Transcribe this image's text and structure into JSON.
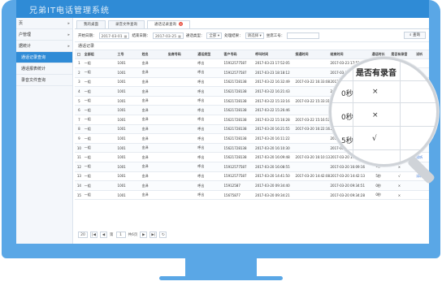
{
  "app": {
    "title": "兄弟IT电话管理系统"
  },
  "sidebar": {
    "items": [
      {
        "label": "页",
        "type": "group"
      },
      {
        "label": "户管理",
        "type": "group"
      },
      {
        "label": "据统计",
        "type": "group"
      },
      {
        "label": "通话记录查询",
        "type": "sub",
        "active": true
      },
      {
        "label": "通话报表统计",
        "type": "sub"
      },
      {
        "label": "录音文件查询",
        "type": "sub"
      }
    ]
  },
  "tabs": [
    {
      "label": "我的桌面"
    },
    {
      "label": "录音文件查询"
    },
    {
      "label": "通话记录查询",
      "active": true,
      "close": "×"
    }
  ],
  "filters": {
    "start_label": "开始日期：",
    "start_value": "2017-03-01",
    "end_label": "结束日期：",
    "end_value": "2017-03-25",
    "type_label": "通话类型：",
    "type_value": "全部",
    "result_label": "处理结果：",
    "result_value": "请选择",
    "agent_label": "坐席工号：",
    "agent_value": "",
    "search_label": "查询"
  },
  "section_title": "通话记录",
  "table": {
    "headers": [
      "全部组",
      "工号",
      "姓名",
      "坐席号码",
      "通话类型",
      "客户号码",
      "呼叫时间",
      "接通时间",
      "结束时间",
      "通话时长",
      "是否有录音",
      "试听"
    ],
    "rows": [
      {
        "no": "1",
        "group": "一组",
        "id": "1001",
        "name": "金泽",
        "ext": "",
        "type": "呼出",
        "phone": "15912577587",
        "call": "2017-03-23 17:52:05",
        "answer": "",
        "end": "2017-03-23 17:52:24",
        "dur": "",
        "rec": "",
        "play": ""
      },
      {
        "no": "2",
        "group": "一组",
        "id": "1001",
        "name": "金泽",
        "ext": "",
        "type": "呼出",
        "phone": "15912577587",
        "call": "2017-03-23 18:18:12",
        "answer": "",
        "end": "2017-03-23 18:18:31",
        "dur": "",
        "rec": "",
        "play": ""
      },
      {
        "no": "3",
        "group": "一组",
        "id": "1001",
        "name": "金泽",
        "ext": "",
        "type": "呼出",
        "phone": "15621728138",
        "call": "2017-03-22 16:32:49",
        "answer": "2017-03-22 16:33:08",
        "end": "2017-03-22 16:33:09",
        "dur": "",
        "rec": "",
        "play": ""
      },
      {
        "no": "4",
        "group": "一组",
        "id": "1001",
        "name": "金泽",
        "ext": "",
        "type": "呼出",
        "phone": "15621728138",
        "call": "2017-03-22 16:21:43",
        "answer": "",
        "end": "2017-03-22 16:22:01",
        "dur": "",
        "rec": "",
        "play": ""
      },
      {
        "no": "5",
        "group": "一组",
        "id": "1001",
        "name": "金泽",
        "ext": "",
        "type": "呼出",
        "phone": "15621728138",
        "call": "2017-03-22 15:33:16",
        "answer": "2017-03-22 15:33:31",
        "end": "2017-03-22 15:33:44",
        "dur": "",
        "rec": "",
        "play": ""
      },
      {
        "no": "6",
        "group": "一组",
        "id": "1001",
        "name": "金泽",
        "ext": "",
        "type": "呼出",
        "phone": "15621728138",
        "call": "2017-03-22 15:26:46",
        "answer": "",
        "end": "2017-03-22 15:27:05",
        "dur": "",
        "rec": "",
        "play": ""
      },
      {
        "no": "7",
        "group": "一组",
        "id": "1001",
        "name": "金泽",
        "ext": "",
        "type": "呼出",
        "phone": "15621728138",
        "call": "2017-03-22 15:16:28",
        "answer": "2017-03-22 15:16:51",
        "end": "2017-03-22 15:17:02",
        "dur": "",
        "rec": "",
        "play": ""
      },
      {
        "no": "8",
        "group": "一组",
        "id": "1001",
        "name": "金泽",
        "ext": "",
        "type": "呼出",
        "phone": "15621728138",
        "call": "2017-03-20 16:21:55",
        "answer": "2017-03-20 16:22:16",
        "end": "2017-03-20 16:22:40",
        "dur": "",
        "rec": "",
        "play": ""
      },
      {
        "no": "9",
        "group": "一组",
        "id": "1001",
        "name": "金泽",
        "ext": "",
        "type": "呼出",
        "phone": "15621728138",
        "call": "2017-03-20 16:11:22",
        "answer": "",
        "end": "2017-03-20 16:11:41",
        "dur": "",
        "rec": "",
        "play": ""
      },
      {
        "no": "10",
        "group": "一组",
        "id": "1001",
        "name": "金泽",
        "ext": "",
        "type": "呼出",
        "phone": "15621728138",
        "call": "2017-03-20 16:10:30",
        "answer": "",
        "end": "2017-03-20 16:10:50",
        "dur": "0秒",
        "rec": "×",
        "play": ""
      },
      {
        "no": "11",
        "group": "一组",
        "id": "1001",
        "name": "金泽",
        "ext": "",
        "type": "呼出",
        "phone": "15621728138",
        "call": "2017-03-20 16:09:48",
        "answer": "2017-03-20 16:10:13",
        "end": "2017-03-20 16:10:18",
        "dur": "5秒",
        "rec": "√",
        "play": "试听"
      },
      {
        "no": "12",
        "group": "一组",
        "id": "1001",
        "name": "金泽",
        "ext": "",
        "type": "呼出",
        "phone": "15912577587",
        "call": "2017-03-20 16:08:55",
        "answer": "",
        "end": "2017-03-20 16:09:16",
        "dur": "0秒",
        "rec": "×",
        "play": ""
      },
      {
        "no": "13",
        "group": "一组",
        "id": "1001",
        "name": "金泽",
        "ext": "",
        "type": "呼出",
        "phone": "15912577587",
        "call": "2017-03-20 14:41:50",
        "answer": "2017-03-20 14:42:08",
        "end": "2017-03-20 14:42:13",
        "dur": "5秒",
        "rec": "√",
        "play": "试听"
      },
      {
        "no": "14",
        "group": "一组",
        "id": "1001",
        "name": "金泽",
        "ext": "",
        "type": "呼出",
        "phone": "15912587",
        "call": "2017-03-20 09:34:40",
        "answer": "",
        "end": "2017-03-20 09:34:51",
        "dur": "0秒",
        "rec": "×",
        "play": ""
      },
      {
        "no": "15",
        "group": "一组",
        "id": "1001",
        "name": "金泽",
        "ext": "",
        "type": "呼出",
        "phone": "15675877",
        "call": "2017-03-20 09:34:21",
        "answer": "",
        "end": "2017-03-20 09:34:28",
        "dur": "0秒",
        "rec": "×",
        "play": ""
      }
    ]
  },
  "pager": {
    "page_size": "20",
    "first": "|◀",
    "prev": "◀",
    "page_label": "第",
    "page_value": "1",
    "total": "共6页",
    "next": "▶",
    "last": "▶|",
    "refresh": "↻"
  },
  "magnifier": {
    "header": "是否有录音",
    "header_prefix": "长",
    "rows": [
      {
        "dur": "0秒",
        "rec": "×"
      },
      {
        "dur": "0秒",
        "rec": "×"
      },
      {
        "dur": "5秒",
        "rec": "√"
      }
    ]
  },
  "colors": {
    "accent": "#2f8bd6",
    "monitor": "#5aa7e6"
  }
}
